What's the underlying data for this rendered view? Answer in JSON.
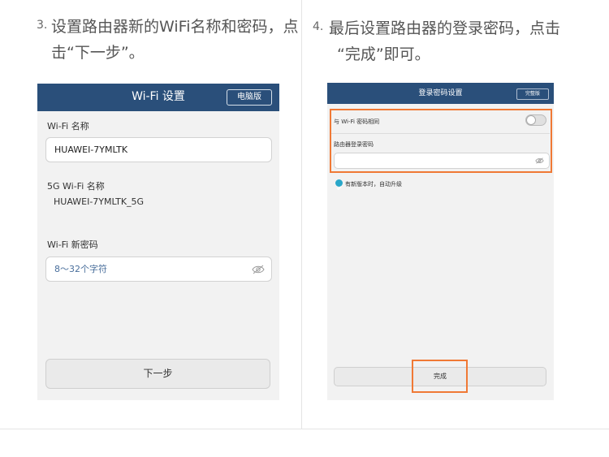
{
  "step3": {
    "number": "3.",
    "line1": "设置路由器新的WiFi名称和密码，点",
    "line2": "击“下一步”。"
  },
  "step4": {
    "number": "4.",
    "line1": "最后设置路由器的登录密码，点击",
    "line2": "“完成”即可。"
  },
  "phone1": {
    "title": "Wi-Fi 设置",
    "pc_version_button": "电脑版",
    "wifi_name_label": "Wi-Fi 名称",
    "wifi_name_value": "HUAWEI-7YMLTK",
    "wifi5g_label": "5G Wi-Fi 名称",
    "wifi5g_value": "HUAWEI-7YMLTK_5G",
    "new_password_label": "Wi-Fi 新密码",
    "new_password_placeholder": "8～32个字符",
    "next_button": "下一步"
  },
  "phone2": {
    "title": "登录密码设置",
    "pc_version_button": "完整版",
    "same_as_wifi_label": "与 Wi-Fi 密码相同",
    "login_password_label": "路由器登录密码",
    "auto_upgrade_label": "有新版本时，自动升级",
    "done_button": "完成",
    "toggle_on": false,
    "auto_upgrade_checked": true
  },
  "colors": {
    "header": "#2a4f7a",
    "highlight": "#f07935",
    "checkbox": "#29a7c9"
  }
}
